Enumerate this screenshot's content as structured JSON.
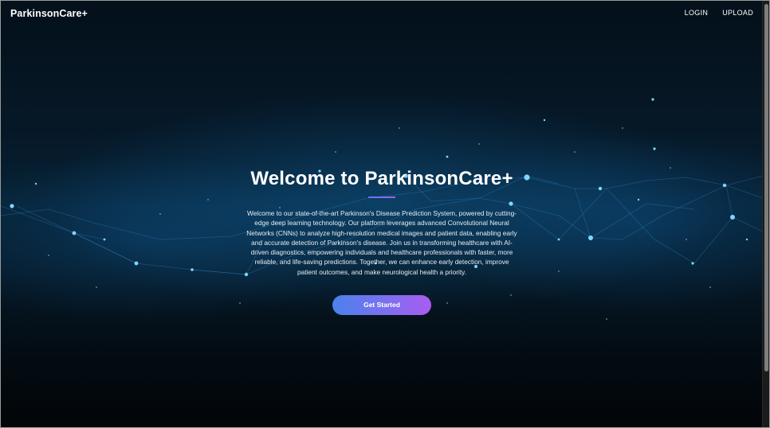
{
  "navbar": {
    "brand": "ParkinsonCare+",
    "links": [
      "LOGIN",
      "UPLOAD"
    ]
  },
  "hero": {
    "title": "Welcome to ParkinsonCare+",
    "description": "Welcome to our state-of-the-art Parkinson's Disease Prediction System, powered by cutting-edge deep learning technology. Our platform leverages advanced Convolutional Neural Networks (CNNs) to analyze high-resolution medical images and patient data, enabling early and accurate detection of Parkinson's disease. Join us in transforming healthcare with AI-driven diagnostics, empowering individuals and healthcare professionals with faster, more reliable, and life-saving predictions. Together, we can enhance early detection, improve patient outcomes, and make neurological health a priority.",
    "cta_label": "Get Started"
  },
  "colors": {
    "cta_gradient_start": "#4b82ec",
    "cta_gradient_end": "#a95cf0",
    "accent_underline": "#7d6ff0",
    "background": "#061827"
  }
}
